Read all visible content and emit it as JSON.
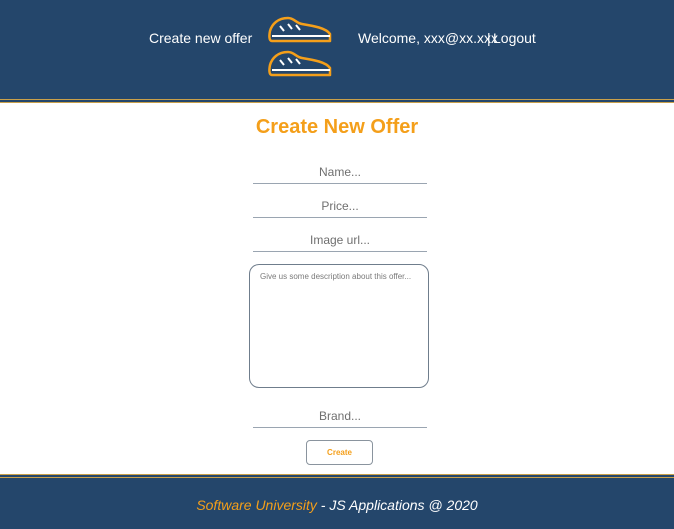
{
  "nav": {
    "create_link": "Create new offer",
    "welcome": "Welcome, xxx@xx.xxx",
    "separator": "|",
    "logout": "Logout"
  },
  "form": {
    "title": "Create New Offer",
    "name_placeholder": "Name...",
    "price_placeholder": "Price...",
    "image_placeholder": "Image url...",
    "description_placeholder": "Give us some description about this offer...",
    "brand_placeholder": "Brand...",
    "submit_label": "Create"
  },
  "footer": {
    "brand": "Software University",
    "rest": " - JS Applications @ 2020"
  },
  "colors": {
    "header_bg": "#24466b",
    "accent": "#f49f1a",
    "gold_rule": "#c9a04a"
  }
}
